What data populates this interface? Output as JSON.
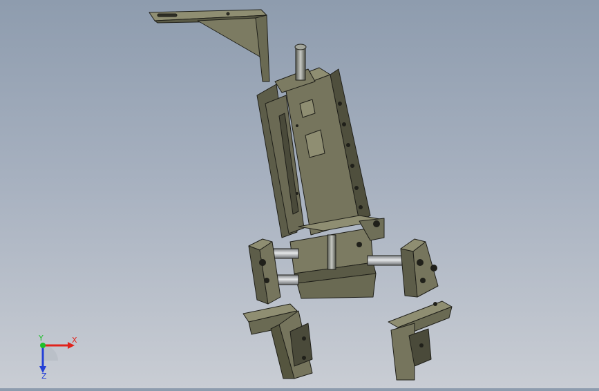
{
  "viewport": {
    "background_top": "#8e9cae",
    "background_bottom": "#c9cdd4"
  },
  "model": {
    "body_color": "#6f6f58",
    "body_light": "#8f8e72",
    "body_dark": "#4a4a3a",
    "rod_color": "#b9bcbf",
    "edge_color": "#1f1f19"
  },
  "triad": {
    "x_label": "X",
    "y_label": "Y",
    "z_label": "Z",
    "x_color": "#e0231c",
    "y_color": "#1fbf2a",
    "z_color": "#2440d6"
  }
}
